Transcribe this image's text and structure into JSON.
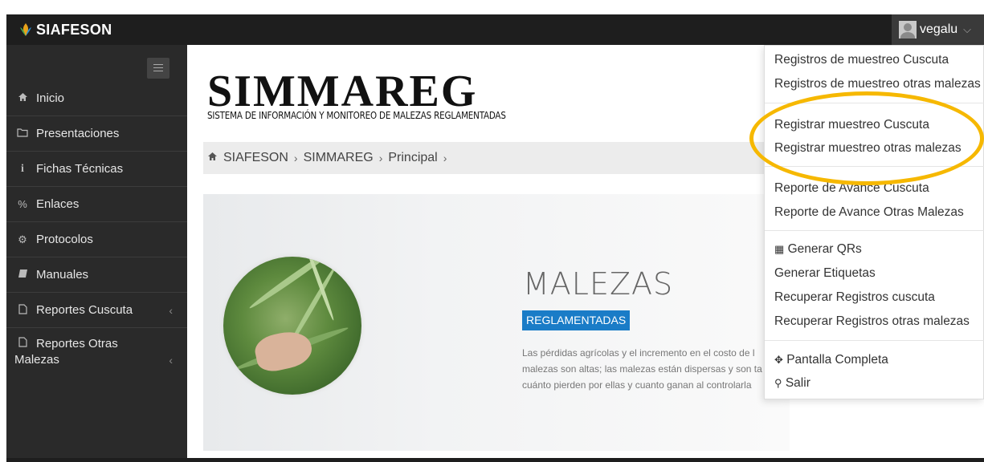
{
  "app": {
    "brand": "SIAFESON"
  },
  "user": {
    "name": "vegalu",
    "caret": "⌵"
  },
  "sidebar": {
    "items": [
      {
        "icon": "home-icon",
        "glyph": "🏠",
        "label": "Inicio"
      },
      {
        "icon": "folder-icon",
        "glyph": "🗀",
        "label": "Presentaciones"
      },
      {
        "icon": "info-icon",
        "glyph": "i",
        "label": "Fichas Técnicas"
      },
      {
        "icon": "link-icon",
        "glyph": "%",
        "label": "Enlaces"
      },
      {
        "icon": "gear-icon",
        "glyph": "⚙",
        "label": "Protocolos"
      },
      {
        "icon": "book-icon",
        "glyph": "▰",
        "label": "Manuales"
      },
      {
        "icon": "file-icon",
        "glyph": "🗋",
        "label": "Reportes Cuscuta",
        "chevron": "‹"
      },
      {
        "icon": "file-icon",
        "glyph": "🗋",
        "label": "Reportes Otras",
        "label2": "Malezas",
        "chevron": "‹"
      }
    ]
  },
  "header": {
    "logo_title": "SIMMAREG",
    "logo_subtitle": "SISTEMA DE INFORMACIÓN Y MONITOREO DE MALEZAS REGLAMENTADAS"
  },
  "breadcrumb": {
    "home_glyph": "🏠",
    "items": [
      "SIAFESON",
      "SIMMAREG",
      "Principal"
    ],
    "sep": "›"
  },
  "banner": {
    "title": "MALEZAS",
    "tag": "REGLAMENTADAS",
    "text_lines": [
      "Las pérdidas agrícolas y el incremento en el costo de l",
      "malezas son altas; las malezas están dispersas y son ta",
      "cuánto pierden por ellas y cuanto ganan al controlarla"
    ]
  },
  "dropdown": {
    "items": [
      "Registros de muestreo Cuscuta",
      "Registros de muestreo otras malezas",
      "Registrar muestreo Cuscuta",
      "Registrar muestreo otras malezas",
      "Reporte de Avance Cuscuta",
      "Reporte de Avance Otras Malezas",
      "Generar QRs",
      "Generar Etiquetas",
      "Recuperar Registros cuscuta",
      "Recuperar Registros otras malezas",
      "Pantalla Completa",
      "Salir"
    ],
    "icons": {
      "qr": "▦",
      "fullscreen": "✥",
      "exit": "⚲"
    }
  },
  "colors": {
    "topbar": "#1e1e1e",
    "sidebar": "#2a2a2a",
    "accent": "#1a7cc7",
    "highlight": "#f6b800"
  }
}
